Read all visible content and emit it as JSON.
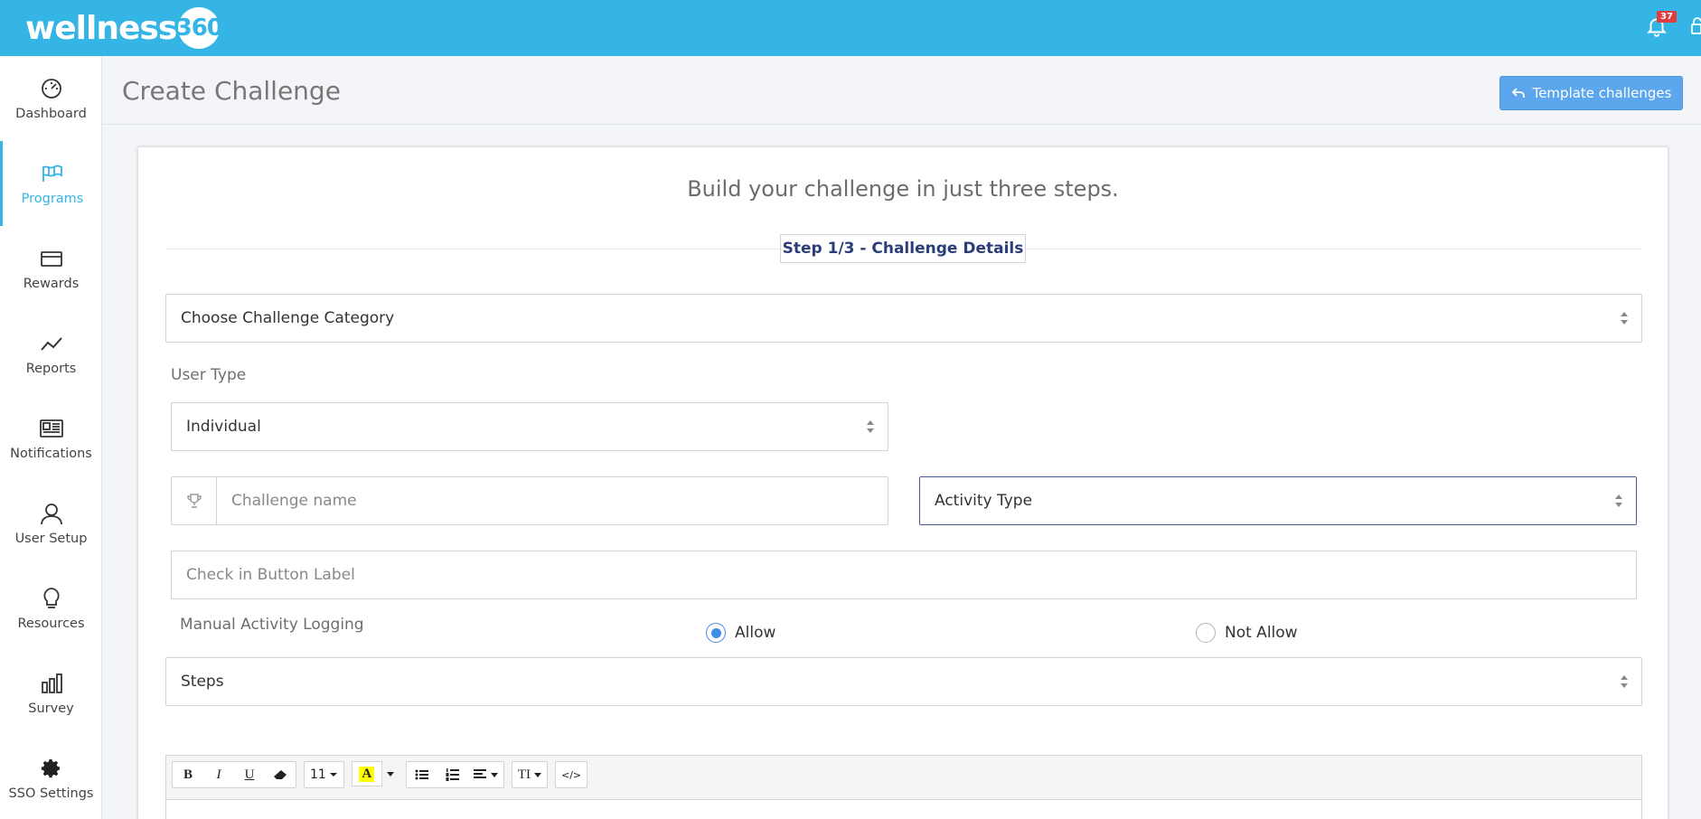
{
  "app": {
    "logo_text": "wellness",
    "logo_badge": "360",
    "notification_count": "37"
  },
  "sidebar": {
    "items": [
      {
        "label": "Dashboard",
        "icon": "speedometer-icon"
      },
      {
        "label": "Programs",
        "icon": "flag-icon",
        "active": true
      },
      {
        "label": "Rewards",
        "icon": "credit-card-icon"
      },
      {
        "label": "Reports",
        "icon": "line-chart-icon"
      },
      {
        "label": "Notifications",
        "icon": "newspaper-icon"
      },
      {
        "label": "User Setup",
        "icon": "user-icon"
      },
      {
        "label": "Resources",
        "icon": "lightbulb-icon"
      },
      {
        "label": "Survey",
        "icon": "bar-chart-icon"
      },
      {
        "label": "SSO Settings",
        "icon": "gear-icon"
      }
    ]
  },
  "header": {
    "title": "Create Challenge",
    "template_button": "Template challenges"
  },
  "form": {
    "intro": "Build your challenge in just three steps.",
    "step_label": "Step 1/3 - Challenge Details",
    "category_select": "Choose Challenge Category",
    "user_type_label": "User Type",
    "user_type_select": "Individual",
    "challenge_name_placeholder": "Challenge name",
    "activity_type_select": "Activity Type",
    "checkin_placeholder": "Check in Button Label",
    "manual_logging_label": "Manual Activity Logging",
    "radio_allow": "Allow",
    "radio_not_allow": "Not Allow",
    "steps_select": "Steps"
  },
  "editor": {
    "bold": "B",
    "italic": "I",
    "underline": "U",
    "font_size": "11",
    "highlight": "A",
    "style": "TI",
    "code": "</>"
  },
  "colors": {
    "topbar": "#34b5e5",
    "accent": "#34b5e5",
    "button": "#5ba6ec",
    "step_text": "#2c3e7a"
  }
}
